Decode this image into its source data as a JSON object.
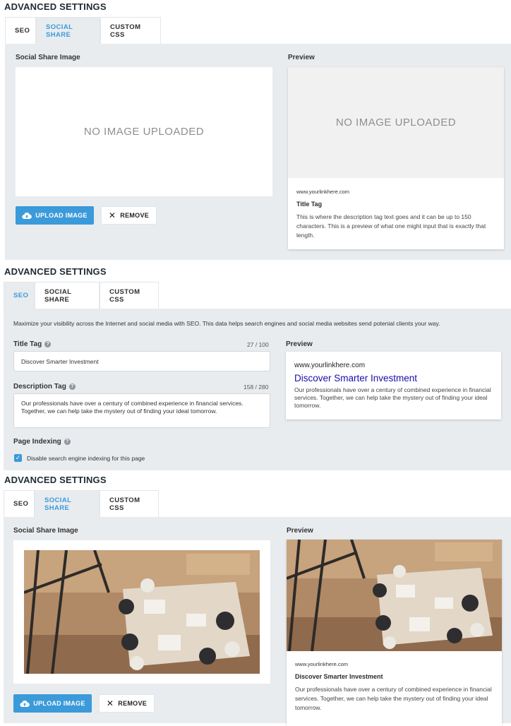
{
  "panel1": {
    "heading": "ADVANCED SETTINGS",
    "tabs": [
      "SEO",
      "SOCIAL SHARE",
      "CUSTOM CSS"
    ],
    "active_tab": "SOCIAL SHARE",
    "image_label": "Social Share Image",
    "no_image_text": "NO IMAGE UPLOADED",
    "upload_label": "UPLOAD IMAGE",
    "remove_label": "REMOVE",
    "preview_label": "Preview",
    "preview": {
      "no_image_text": "NO IMAGE UPLOADED",
      "url": "www.yourlinkhere.com",
      "title": "Title Tag",
      "description": "This is where the description tag text goes and it can be up to 150 characters. This is a preview of what one might input that is exactly that length."
    }
  },
  "panel2": {
    "heading": "ADVANCED SETTINGS",
    "tabs": [
      "SEO",
      "SOCIAL SHARE",
      "CUSTOM CSS"
    ],
    "active_tab": "SEO",
    "intro": "Maximize your visibility across the Internet and social media with SEO. This data helps search engines and social media websites send potenial clients your way.",
    "title_tag_label": "Title Tag",
    "title_tag_counter": "27 / 100",
    "title_tag_value": "Discover Smarter Investment",
    "description_tag_label": "Description Tag",
    "description_tag_counter": "158 / 280",
    "description_tag_value": "Our professionals have over a century of combined experience in financial services. Together, we can help take the mystery out of finding your ideal tomorrow.",
    "page_indexing_label": "Page Indexing",
    "checkbox_label": "Disable search engine indexing for this page",
    "checkbox_checked": true,
    "preview_label": "Preview",
    "preview": {
      "url": "www.yourlinkhere.com",
      "title": "Discover Smarter Investment",
      "description": "Our professionals have over a century of combined experience in financial services. Together, we can help take the mystery out of finding your ideal tomorrow.",
      "title_color": "#1a0dab"
    }
  },
  "panel3": {
    "heading": "ADVANCED SETTINGS",
    "tabs": [
      "SEO",
      "SOCIAL SHARE",
      "CUSTOM CSS"
    ],
    "active_tab": "SOCIAL SHARE",
    "image_label": "Social Share Image",
    "upload_label": "UPLOAD IMAGE",
    "remove_label": "REMOVE",
    "preview_label": "Preview",
    "preview": {
      "url": "www.yourlinkhere.com",
      "title": "Discover Smarter Investment",
      "description": "Our professionals have over a century of combined experience in financial services. Together, we can help take the mystery out of finding your ideal tomorrow."
    }
  },
  "colors": {
    "accent": "#3b9ad9",
    "panel_bg": "#e9ecef"
  }
}
